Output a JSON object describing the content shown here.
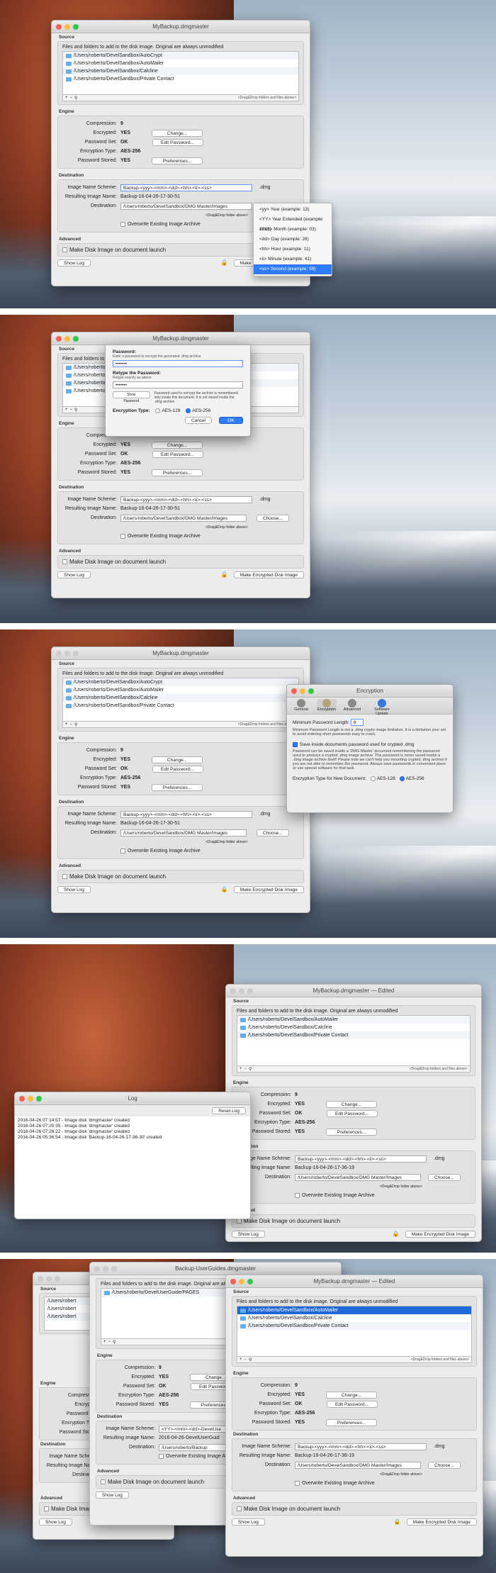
{
  "window_title": "MyBackup.dmgmaster",
  "window_title_edited": "MyBackup.dmgmaster — Edited",
  "source": {
    "section_label": "Source",
    "description": "Files and folders to add to the disk image. Original are always unmodified",
    "items": [
      "/Users/roberto/DevelSandbox/AutoCrypt",
      "/Users/roberto/DevelSandbox/AutoMailer",
      "/Users/roberto/DevelSandbox/Calcline",
      "/Users/roberto/DevelSandbox/Private Contact"
    ],
    "items_short": [
      "/Users/roberto/DevelSandbox/AutoMailer",
      "/Users/roberto/DevelSandbox/Calcline",
      "/Users/roberto/DevelSandbox/Private Contact"
    ],
    "drag_hint": "<Drag&Drop folders and files above>",
    "add": "+",
    "remove": "−"
  },
  "engine": {
    "section_label": "Engine",
    "compression_label": "Compression:",
    "compression_value": "9",
    "encrypted_label": "Encrypted:",
    "encrypted_value": "YES",
    "change_button": "Change...",
    "password_set_label": "Password Set:",
    "password_set_value": "OK",
    "edit_password_button": "Edit Password...",
    "encryption_type_label": "Encryption Type:",
    "encryption_type_value": "AES-256",
    "password_stored_label": "Password Stored:",
    "password_stored_value": "YES",
    "preferences_button": "Preferences..."
  },
  "destination": {
    "section_label": "Destination",
    "scheme_label": "Image Name Scheme:",
    "scheme_value": "Backup-<yyy>-<mm>-<dd>-<hh>-<ii>-<ss>",
    "ext": ".dmg",
    "resulting_label": "Resulting Image Name:",
    "resulting_value": "Backup-16-04-26-17-30-51",
    "resulting_value_4": "Backup-16-04-26-17-36-19",
    "destination_label": "Destination:",
    "destination_value": "/Users/roberto/DevelSandbox/DMG Master/Images",
    "dest_hint": "<Drag&Drop folder above>",
    "choose_button": "Choose...",
    "overwrite_label": "Overwrite Existing Image Archive"
  },
  "advanced": {
    "section_label": "Advanced",
    "make_on_launch_label": "Make Disk Image on document launch"
  },
  "footer": {
    "show_log": "Show Log",
    "make_button": "Make Encrypted Disk Image"
  },
  "scheme_menu": [
    "<yy> Year (example: 13)",
    "<YY> Year Extended (example: 2013)",
    "<mm> Month (example: 03)",
    "<dd> Day (example: 28)",
    "<hh> Hour (example: 11)",
    "<ii> Minute (example: 41)",
    "<ss> Second (example: 59)"
  ],
  "password_sheet": {
    "password_title": "Password:",
    "password_hint": "Enter a password to encrypt the generated .dmg archive",
    "password_value": "•••••••",
    "retype_title": "Retype the Password:",
    "retype_hint": "Retype exactly as above",
    "retype_value": "•••••••",
    "show_password": "Show Password",
    "note": "Password used to encrypt the archive is remembered only inside this document. It is not stored inside the .dmg archive",
    "encryption_type_label": "Encryption Type:",
    "aes128": "AES-128",
    "aes256": "AES-256",
    "cancel": "Cancel",
    "ok": "OK"
  },
  "prefs": {
    "title": "Encryption",
    "tabs": [
      "General",
      "Encryption",
      "Advanced",
      "Software Update"
    ],
    "min_len_label": "Minimum Password Length:",
    "min_len_value": "6",
    "min_len_note": "Minimum Password Length is not a .dmg crypto image limitation. It is a limitation your set to avoid entering short passwords easy to crack.",
    "save_inside_label": "Save inside documents password used for crypted .dmg",
    "save_inside_note": "Password can be saved inside a 'DMG Master' document remembering the password used to produce a crypted .dmg image archive. The password is never saved inside a .dmg image archive itself! Please note we can't help you mounting crypted .dmg archive if you are not able to remember the password. Always save passwords in convenient place or use special software for that task.",
    "enc_type_label": "Encryption Type for New Document:",
    "aes128": "AES-128",
    "aes256": "AES-256"
  },
  "log": {
    "title": "Log",
    "reset_button": "Reset Log",
    "lines": [
      "2016-04-26 07:14:57 - Image disk 'dmgmaster' created",
      "2016-04-26 07:20:35 - Image disk 'dmgmaster' created",
      "2016-04-26 07:26:22 - Image disk 'dmgmaster' created",
      "2016-04-26 05:36:54 - Image disk 'Backup-16-04-26-17-36-30' created"
    ]
  },
  "s5": {
    "back_title": "Backup-UserGuides.dmgmaster",
    "back_items": [
      "/Users/roberto/DevelUserGuide/PAGES"
    ],
    "back_scheme": "<YY>-<mm>-<dd>-DevelUse",
    "back_resulting": "2016-04-26-DevelUserGuid",
    "back_destination": "/Users/roberto/Backup",
    "left_items": [
      "/Users/robert",
      "/Users/robert",
      "/Users/robert"
    ],
    "front_resulting": "Backup-16-04-26-17-36-19"
  }
}
